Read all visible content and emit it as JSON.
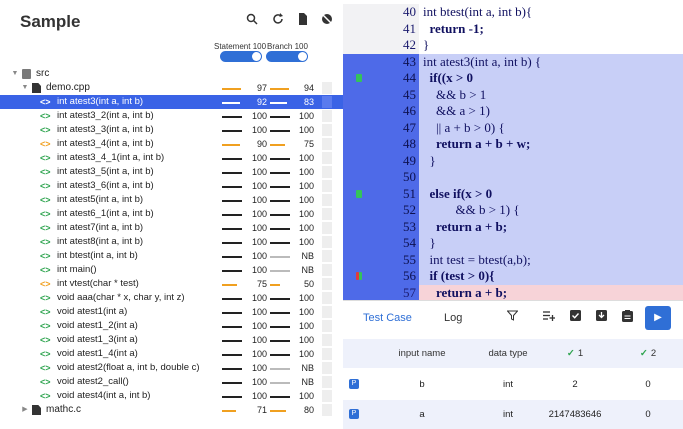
{
  "app": {
    "title": "Sample"
  },
  "toolbar": {
    "icons": [
      "search-icon",
      "refresh-icon",
      "file-icon",
      "hide-icon"
    ]
  },
  "coverage_header": {
    "statement": "Statement 100",
    "branch": "Branch 100"
  },
  "tree": [
    {
      "type": "folder",
      "label": "src",
      "indent": 0,
      "expanded": true
    },
    {
      "type": "file",
      "label": "demo.cpp",
      "indent": 1,
      "expanded": true,
      "stmt": "97",
      "branch": "94",
      "stmt_level": 0.97,
      "branch_level": 0.94,
      "stmt_color": "orange",
      "branch_color": "orange"
    },
    {
      "type": "func",
      "label": "int atest3(int a, int b)",
      "selected": true,
      "icon": "orange",
      "stmt": "92",
      "branch": "83",
      "stmt_level": 0.92,
      "branch_level": 0.83,
      "stmt_color": "orange",
      "branch_color": "orange"
    },
    {
      "type": "func",
      "label": "int atest3_2(int a, int b)",
      "icon": "green",
      "stmt": "100",
      "branch": "100",
      "stmt_level": 1,
      "branch_level": 1
    },
    {
      "type": "func",
      "label": "int atest3_3(int a, int b)",
      "icon": "green",
      "stmt": "100",
      "branch": "100",
      "stmt_level": 1,
      "branch_level": 1
    },
    {
      "type": "func",
      "label": "int atest3_4(int a, int b)",
      "icon": "orange",
      "stmt": "90",
      "branch": "75",
      "stmt_level": 0.9,
      "branch_level": 0.75,
      "stmt_color": "orange",
      "branch_color": "orange"
    },
    {
      "type": "func",
      "label": "int atest3_4_1(int a, int b)",
      "icon": "green",
      "stmt": "100",
      "branch": "100",
      "stmt_level": 1,
      "branch_level": 1
    },
    {
      "type": "func",
      "label": "int atest3_5(int a, int b)",
      "icon": "green",
      "stmt": "100",
      "branch": "100",
      "stmt_level": 1,
      "branch_level": 1
    },
    {
      "type": "func",
      "label": "int atest3_6(int a, int b)",
      "icon": "green",
      "stmt": "100",
      "branch": "100",
      "stmt_level": 1,
      "branch_level": 1
    },
    {
      "type": "func",
      "label": "int atest5(int a, int b)",
      "icon": "green",
      "stmt": "100",
      "branch": "100",
      "stmt_level": 1,
      "branch_level": 1
    },
    {
      "type": "func",
      "label": "int atest6_1(int a, int b)",
      "icon": "green",
      "stmt": "100",
      "branch": "100",
      "stmt_level": 1,
      "branch_level": 1
    },
    {
      "type": "func",
      "label": "int atest7(int a, int b)",
      "icon": "green",
      "stmt": "100",
      "branch": "100",
      "stmt_level": 1,
      "branch_level": 1
    },
    {
      "type": "func",
      "label": "int atest8(int a, int b)",
      "icon": "green",
      "stmt": "100",
      "branch": "100",
      "stmt_level": 1,
      "branch_level": 1
    },
    {
      "type": "func",
      "label": "int btest(int a, int b)",
      "icon": "green",
      "stmt": "100",
      "branch": "NB",
      "stmt_level": 1,
      "branch_level": 1,
      "branch_color": "grey"
    },
    {
      "type": "func",
      "label": "int main()",
      "icon": "green",
      "stmt": "100",
      "branch": "NB",
      "stmt_level": 1,
      "branch_level": 1,
      "branch_color": "grey"
    },
    {
      "type": "func",
      "label": "int vtest(char * test)",
      "icon": "orange",
      "stmt": "75",
      "branch": "50",
      "stmt_level": 0.75,
      "branch_level": 0.5,
      "stmt_color": "orange",
      "branch_color": "orange"
    },
    {
      "type": "func",
      "label": "void aaa(char * x, char y, int z)",
      "icon": "green",
      "stmt": "100",
      "branch": "100",
      "stmt_level": 1,
      "branch_level": 1
    },
    {
      "type": "func",
      "label": "void atest1(int a)",
      "icon": "green",
      "stmt": "100",
      "branch": "100",
      "stmt_level": 1,
      "branch_level": 1
    },
    {
      "type": "func",
      "label": "void atest1_2(int a)",
      "icon": "green",
      "stmt": "100",
      "branch": "100",
      "stmt_level": 1,
      "branch_level": 1
    },
    {
      "type": "func",
      "label": "void atest1_3(int a)",
      "icon": "green",
      "stmt": "100",
      "branch": "100",
      "stmt_level": 1,
      "branch_level": 1
    },
    {
      "type": "func",
      "label": "void atest1_4(int a)",
      "icon": "green",
      "stmt": "100",
      "branch": "100",
      "stmt_level": 1,
      "branch_level": 1
    },
    {
      "type": "func",
      "label": "void atest2(float a, int b, double c)",
      "icon": "green",
      "stmt": "100",
      "branch": "NB",
      "stmt_level": 1,
      "branch_level": 1,
      "branch_color": "grey"
    },
    {
      "type": "func",
      "label": "void atest2_call()",
      "icon": "green",
      "stmt": "100",
      "branch": "NB",
      "stmt_level": 1,
      "branch_level": 1,
      "branch_color": "grey"
    },
    {
      "type": "func",
      "label": "void atest4(int a, int b)",
      "icon": "green",
      "stmt": "100",
      "branch": "100",
      "stmt_level": 1,
      "branch_level": 1
    },
    {
      "type": "file",
      "label": "mathc.c",
      "indent": 1,
      "expanded": false,
      "stmt": "71",
      "branch": "80",
      "stmt_level": 0.71,
      "branch_level": 0.8,
      "stmt_color": "orange",
      "branch_color": "orange"
    }
  ],
  "code": [
    {
      "n": "40",
      "text": "int btest(int a, int b){",
      "state": "plain"
    },
    {
      "n": "41",
      "text": "  return -1;",
      "state": "plain",
      "bold": true
    },
    {
      "n": "42",
      "text": "}",
      "state": "plain"
    },
    {
      "n": "43",
      "text": "int atest3(int a, int b) {",
      "state": "cov"
    },
    {
      "n": "44",
      "text": "  if((x > 0",
      "state": "cov",
      "bold": true,
      "mark": "green"
    },
    {
      "n": "45",
      "text": "    && b > 1",
      "state": "cov"
    },
    {
      "n": "46",
      "text": "    && a > 1)",
      "state": "cov"
    },
    {
      "n": "47",
      "text": "    || a + b > 0) {",
      "state": "cov"
    },
    {
      "n": "48",
      "text": "    return a + b + w;",
      "state": "cov",
      "bold": true
    },
    {
      "n": "49",
      "text": "  }",
      "state": "cov"
    },
    {
      "n": "50",
      "text": "",
      "state": "cov"
    },
    {
      "n": "51",
      "text": "  else if(x > 0",
      "state": "cov",
      "bold": true,
      "mark": "green"
    },
    {
      "n": "52",
      "text": "          && b > 1) {",
      "state": "cov"
    },
    {
      "n": "53",
      "text": "    return a + b;",
      "state": "cov",
      "bold": true
    },
    {
      "n": "54",
      "text": "  }",
      "state": "cov"
    },
    {
      "n": "55",
      "text": "  int test = btest(a,b);",
      "state": "cov"
    },
    {
      "n": "56",
      "text": "  if (test > 0){",
      "state": "cov",
      "bold": true,
      "mark": "red"
    },
    {
      "n": "57",
      "text": "    return a + b;",
      "state": "uncov",
      "bold": true
    }
  ],
  "bottom": {
    "tabs": {
      "testcase": "Test Case",
      "log": "Log"
    },
    "icons": [
      "filter-icon",
      "add-list-icon",
      "check-square-icon",
      "download-icon",
      "clipboard-icon"
    ],
    "run_icon": "▶",
    "table": {
      "headers": {
        "name": "input name",
        "type": "data type",
        "case1": "1",
        "case2": "2"
      },
      "rows": [
        {
          "name": "b",
          "type": "int",
          "c1": "2",
          "c2": "0"
        },
        {
          "name": "a",
          "type": "int",
          "c1": "2147483646",
          "c2": "0"
        }
      ]
    }
  }
}
